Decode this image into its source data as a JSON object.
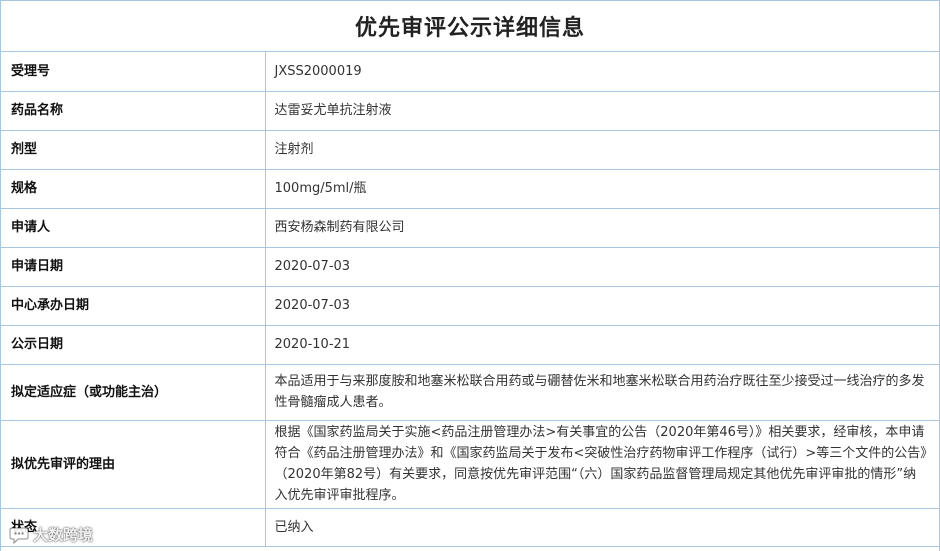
{
  "page": {
    "title": "优先审评公示详细信息"
  },
  "rows": [
    {
      "label": "受理号",
      "value": "JXSS2000019"
    },
    {
      "label": "药品名称",
      "value": "达雷妥尤单抗注射液"
    },
    {
      "label": "剂型",
      "value": "注射剂"
    },
    {
      "label": "规格",
      "value": "100mg/5ml/瓶"
    },
    {
      "label": "申请人",
      "value": "西安杨森制药有限公司"
    },
    {
      "label": "申请日期",
      "value": "2020-07-03"
    },
    {
      "label": "中心承办日期",
      "value": "2020-07-03"
    },
    {
      "label": "公示日期",
      "value": "2020-10-21"
    },
    {
      "label": "拟定适应症（或功能主治）",
      "value": "本品适用于与来那度胺和地塞米松联合用药或与硼替佐米和地塞米松联合用药治疗既往至少接受过一线治疗的多发性骨髓瘤成人患者。"
    },
    {
      "label": "拟优先审评的理由",
      "value": "根据《国家药监局关于实施<药品注册管理办法>有关事宜的公告（2020年第46号）》相关要求，经审核，本申请符合《药品注册管理办法》和《国家药监局关于发布<突破性治疗药物审评工作程序（试行）>等三个文件的公告》（2020年第82号）有关要求，同意按优先审评范围“（六）国家药品监督管理局规定其他优先审评审批的情形”纳入优先审评审批程序。"
    },
    {
      "label": "状态",
      "value": "已纳入"
    }
  ],
  "watermark": {
    "text": "大数跨境",
    "icon": "chat-bubble-logo-icon"
  }
}
